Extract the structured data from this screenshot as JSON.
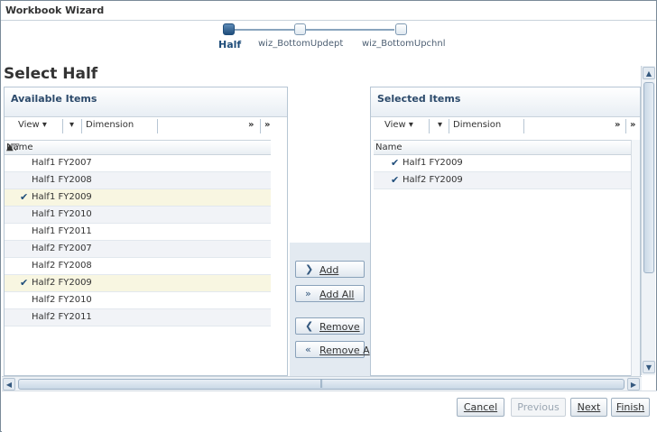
{
  "window": {
    "title": "Workbook Wizard"
  },
  "train": {
    "steps": [
      {
        "label": "Half",
        "active": true
      },
      {
        "label": "wiz_BottomUpdept",
        "active": false
      },
      {
        "label": "wiz_BottomUpchnl",
        "active": false
      }
    ]
  },
  "page": {
    "title": "Select Half"
  },
  "available": {
    "header": "Available Items",
    "toolbar": {
      "view": "View",
      "dimension": "Dimension"
    },
    "column": "Name",
    "items": [
      {
        "label": "Half1 FY2007",
        "checked": false
      },
      {
        "label": "Half1 FY2008",
        "checked": false
      },
      {
        "label": "Half1 FY2009",
        "checked": true
      },
      {
        "label": "Half1 FY2010",
        "checked": false
      },
      {
        "label": "Half1 FY2011",
        "checked": false
      },
      {
        "label": "Half2 FY2007",
        "checked": false
      },
      {
        "label": "Half2 FY2008",
        "checked": false
      },
      {
        "label": "Half2 FY2009",
        "checked": true
      },
      {
        "label": "Half2 FY2010",
        "checked": false
      },
      {
        "label": "Half2 FY2011",
        "checked": false
      }
    ]
  },
  "selected": {
    "header": "Selected Items",
    "toolbar": {
      "view": "View",
      "dimension": "Dimension"
    },
    "column": "Name",
    "items": [
      {
        "label": "Half1 FY2009",
        "checked": true
      },
      {
        "label": "Half2 FY2009",
        "checked": true
      }
    ]
  },
  "shuttle": {
    "add": "Add",
    "add_all": "Add All",
    "remove": "Remove",
    "remove_all": "Remove A"
  },
  "footer": {
    "cancel": "Cancel",
    "previous": "Previous",
    "next": "Next",
    "finish": "Finish"
  },
  "colors": {
    "accent": "#1f4d7a",
    "panel_border": "#b7c6d4",
    "shuttle_bg": "#e3eaf1",
    "selected_row": "#f8f6e1",
    "alt_row": "#f1f3f7"
  }
}
